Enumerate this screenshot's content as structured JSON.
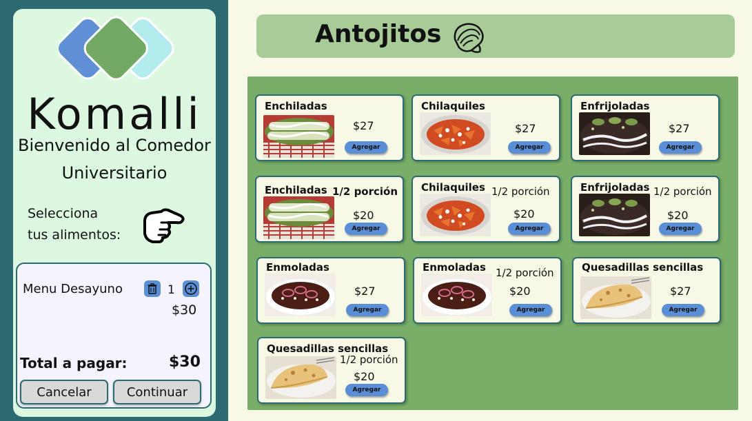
{
  "sidebar": {
    "brand": "Komalli",
    "welcome_line1": "Bienvenido al Comedor",
    "welcome_line2": "Universitario",
    "select_line1": "Selecciona",
    "select_line2": "tus alimentos:",
    "pointer_icon": "pointing-hand-icon",
    "logo_colors": [
      "#5f8fd4",
      "#72a964",
      "#b3ecec"
    ]
  },
  "cart": {
    "items": [
      {
        "name": "Menu Desayuno",
        "quantity": "1",
        "price": "$30"
      }
    ],
    "total_label": "Total a pagar:",
    "total_value": "$30",
    "cancel_label": "Cancelar",
    "continue_label": "Continuar"
  },
  "header": {
    "title": "Antojitos",
    "icon": "taco-icon"
  },
  "menu": {
    "add_label": "Agregar",
    "items": [
      {
        "title": "Enchiladas",
        "portion": "",
        "price": "$27",
        "dish": "enchiladas"
      },
      {
        "title": "Chilaquiles",
        "portion": "",
        "price": "$27",
        "dish": "chilaquiles"
      },
      {
        "title": "Enfrijoladas",
        "portion": "",
        "price": "$27",
        "dish": "enfrijoladas"
      },
      {
        "title": "Enchiladas",
        "portion": "1/2 porción",
        "price": "$20",
        "dish": "enchiladas"
      },
      {
        "title": "Chilaquiles",
        "portion": "1/2 porción",
        "price": "$20",
        "dish": "chilaquiles"
      },
      {
        "title": "Enfrijoladas",
        "portion": "1/2 porción",
        "price": "$20",
        "dish": "enfrijoladas"
      },
      {
        "title": "Enmoladas",
        "portion": "",
        "price": "$27",
        "dish": "enmoladas"
      },
      {
        "title": "Enmoladas",
        "portion": "1/2 porción",
        "price": "$20",
        "dish": "enmoladas"
      },
      {
        "title": "Quesadillas sencillas",
        "portion": "",
        "price": "$27",
        "dish": "quesadillas"
      },
      {
        "title": "Quesadillas sencillas",
        "portion": "1/2 porción",
        "price": "$20",
        "dish": "quesadillas"
      }
    ]
  },
  "colors": {
    "sidebar_bg": "#2b6a70",
    "panel_green": "#78ae68",
    "header_green": "#a8cc98",
    "button_blue": "#5a8fd8",
    "card_bg": "#f8f8e6"
  }
}
